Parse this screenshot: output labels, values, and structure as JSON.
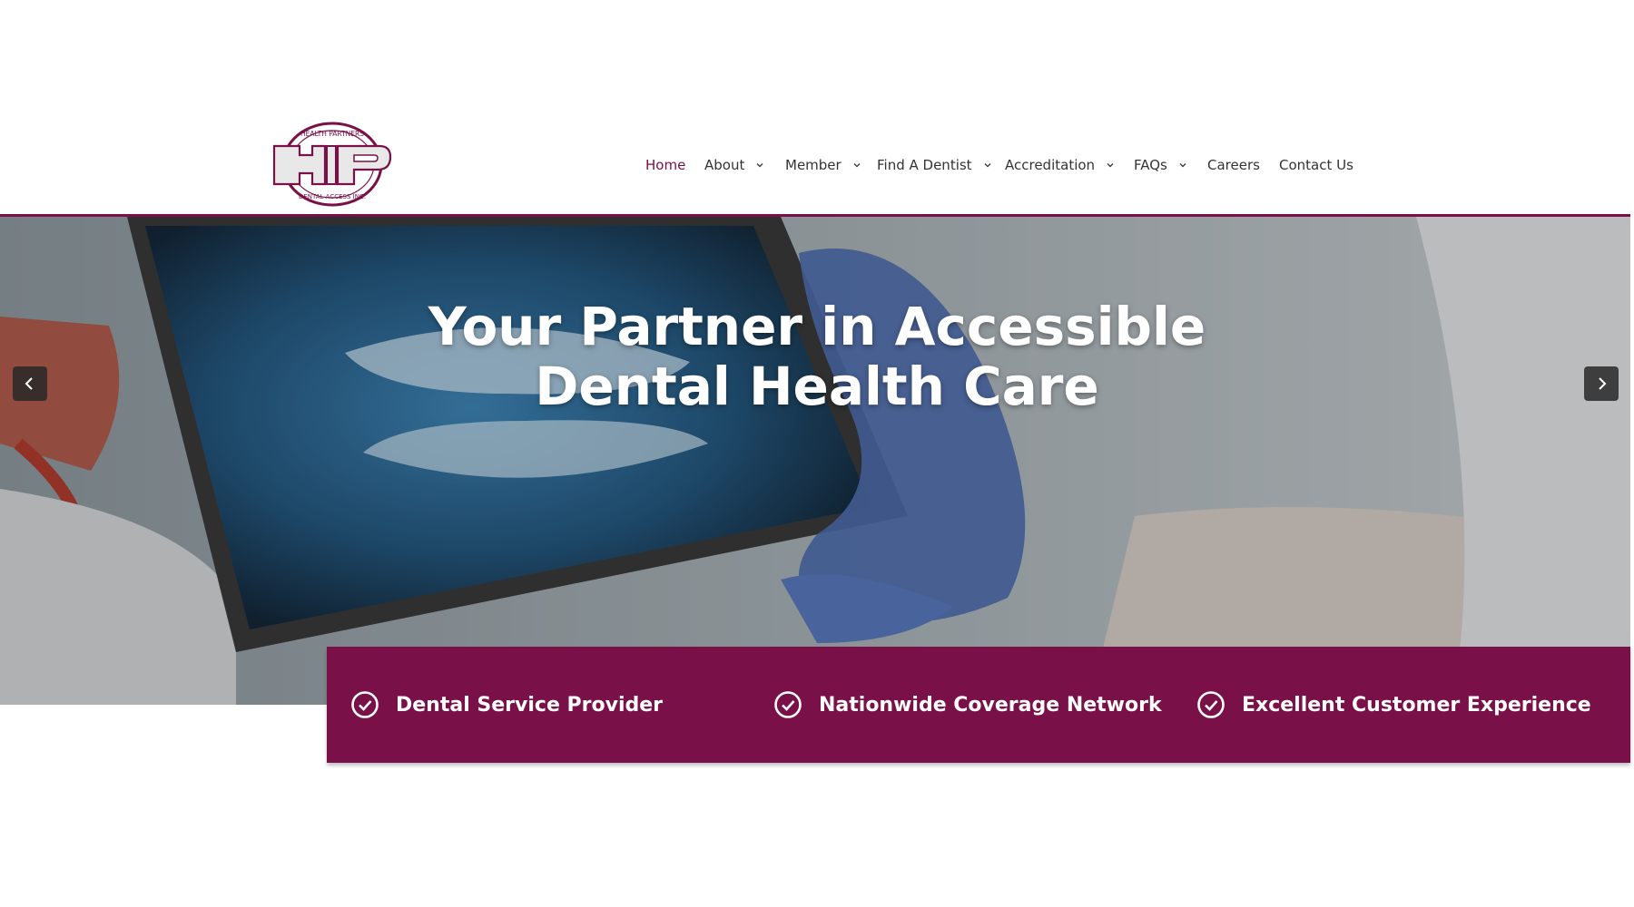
{
  "brand": {
    "logo_letters": "HP",
    "logo_top_text": "HEALTH PARTNERS",
    "logo_bottom_text": "DENTAL ACCESS INC.",
    "color": "#7a1048"
  },
  "nav": {
    "items": [
      {
        "label": "Home",
        "active": true,
        "dropdown": false
      },
      {
        "label": "About",
        "active": false,
        "dropdown": true
      },
      {
        "label": "Member",
        "active": false,
        "dropdown": true
      },
      {
        "label": "Find A Dentist",
        "active": false,
        "dropdown": true
      },
      {
        "label": "Accreditation",
        "active": false,
        "dropdown": true
      },
      {
        "label": "FAQs",
        "active": false,
        "dropdown": true
      },
      {
        "label": "Careers",
        "active": false,
        "dropdown": false
      },
      {
        "label": "Contact Us",
        "active": false,
        "dropdown": false
      }
    ]
  },
  "hero": {
    "title_line1": "Your Partner in Accessible",
    "title_line2": "Dental Health Care",
    "prev_icon": "chevron-left-icon",
    "next_icon": "chevron-right-icon"
  },
  "features": {
    "items": [
      {
        "label": "Dental Service Provider",
        "icon": "check-circle-icon"
      },
      {
        "label": "Nationwide Coverage Network",
        "icon": "check-circle-icon"
      },
      {
        "label": "Excellent Customer Experience",
        "icon": "check-circle-icon"
      }
    ]
  },
  "colors": {
    "accent": "#7a1048",
    "nav_text": "#333333",
    "white": "#ffffff"
  }
}
